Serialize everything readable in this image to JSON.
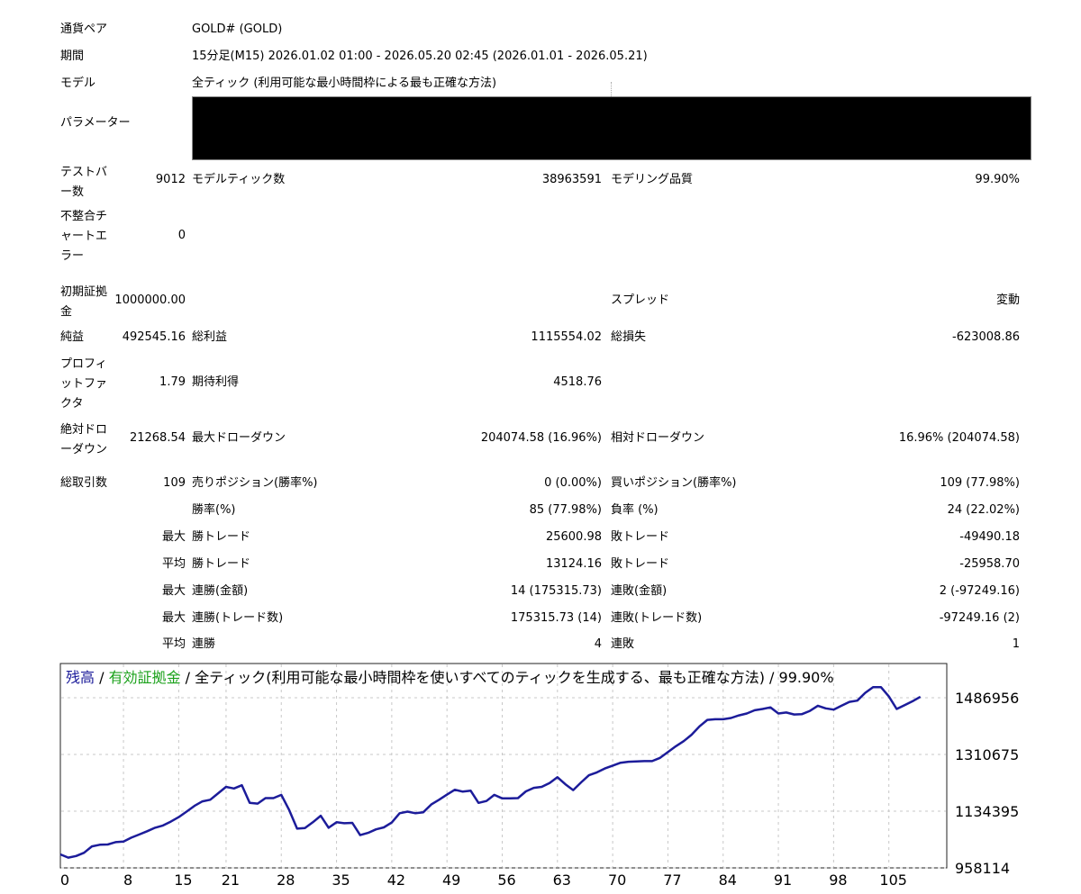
{
  "rows": {
    "pair": {
      "label": "通貨ペア",
      "value": "GOLD# (GOLD)"
    },
    "period": {
      "label": "期間",
      "value": "15分足(M15) 2026.01.02 01:00 - 2026.05.20 02:45 (2026.01.01 - 2026.05.21)"
    },
    "model": {
      "label": "モデル",
      "value": "全ティック (利用可能な最小時間枠による最も正確な方法)"
    },
    "params": {
      "label": "パラメーター"
    },
    "bars": {
      "label": "テストバー数",
      "value": "9012",
      "label2": "モデルティック数",
      "value2": "38963591",
      "label3": "モデリング品質",
      "value3": "99.90%"
    },
    "mismatch": {
      "label": "不整合チャートエラー",
      "value": "0"
    },
    "deposit": {
      "label": "初期証拠金",
      "value": "1000000.00",
      "label3": "スプレッド",
      "value3": "変動"
    },
    "net": {
      "label": "純益",
      "value": "492545.16",
      "label2": "総利益",
      "value2": "1115554.02",
      "label3": "総損失",
      "value3": "-623008.86"
    },
    "pf": {
      "label": "プロフィットファクタ",
      "value": "1.79",
      "label2": "期待利得",
      "value2": "4518.76"
    },
    "dd": {
      "label": "絶対ドローダウン",
      "value": "21268.54",
      "label2": "最大ドローダウン",
      "value2": "204074.58 (16.96%)",
      "label3": "相対ドローダウン",
      "value3": "16.96% (204074.58)"
    },
    "trades": {
      "label": "総取引数",
      "value": "109",
      "label2": "売りポジション(勝率%)",
      "value2": "0 (0.00%)",
      "label3": "買いポジション(勝率%)",
      "value3": "109 (77.98%)"
    },
    "winrate": {
      "label2": "勝率(%)",
      "value2": "85 (77.98%)",
      "label3": "負率 (%)",
      "value3": "24 (22.02%)"
    },
    "maxtrade": {
      "prefix": "最大",
      "label2": "勝トレード",
      "value2": "25600.98",
      "label3": "敗トレード",
      "value3": "-49490.18"
    },
    "avgtrade": {
      "prefix": "平均",
      "label2": "勝トレード",
      "value2": "13124.16",
      "label3": "敗トレード",
      "value3": "-25958.70"
    },
    "maxconsec": {
      "prefix": "最大",
      "label2": "連勝(金額)",
      "value2": "14 (175315.73)",
      "label3": "連敗(金額)",
      "value3": "2 (-97249.16)"
    },
    "maxconsecn": {
      "prefix": "最大",
      "label2": "連勝(トレード数)",
      "value2": "175315.73 (14)",
      "label3": "連敗(トレード数)",
      "value3": "-97249.16 (2)"
    },
    "avgconsec": {
      "prefix": "平均",
      "label2": "連勝",
      "value2": "4",
      "label3": "連敗",
      "value3": "1"
    }
  },
  "chart_data": {
    "type": "line",
    "legend": {
      "balance": "残高",
      "sep1": " / ",
      "equity": "有効証拠金",
      "rest": " / 全ティック(利用可能な最小時間枠を使いすべてのティックを生成する、最も正確な方法) / 99.90%"
    },
    "colors": {
      "balance": "#1c1c9a",
      "equity": "#1aa11a"
    },
    "x_ticks": [
      0,
      8,
      15,
      21,
      28,
      35,
      42,
      49,
      56,
      63,
      70,
      77,
      84,
      91,
      98,
      105
    ],
    "y_ticks": [
      "958114",
      "1134395",
      "1310675",
      "1486956"
    ],
    "ylim": [
      958114,
      1486956
    ],
    "xlim": [
      0,
      112
    ],
    "grid": true,
    "series": [
      {
        "x": [
          0,
          1,
          2,
          3,
          4,
          5,
          6,
          7,
          8,
          9,
          10,
          11,
          12,
          13,
          14,
          15,
          16,
          17,
          18,
          19,
          20,
          21,
          22,
          23,
          24,
          25,
          26,
          27,
          28,
          29,
          30,
          31,
          32,
          33,
          34,
          35,
          36,
          37,
          38,
          39,
          40,
          41,
          42,
          43,
          44,
          45,
          46,
          47,
          48,
          49,
          50,
          51,
          52,
          53,
          54,
          55,
          56,
          57,
          58,
          59,
          60,
          61,
          62,
          63,
          64,
          65,
          66,
          67,
          68,
          69,
          70,
          71,
          72,
          73,
          74,
          75,
          76,
          77,
          78,
          79,
          80,
          81,
          82,
          83,
          84,
          85,
          86,
          87,
          88,
          89,
          90,
          91,
          92,
          93,
          94,
          95,
          96,
          97,
          98,
          99,
          100,
          101,
          102,
          103,
          104,
          105,
          106,
          107,
          108,
          109
        ],
        "values": [
          1000000,
          990000,
          995000,
          1005000,
          1025000,
          1030000,
          1031000,
          1038000,
          1040000,
          1052000,
          1062000,
          1072000,
          1083000,
          1090000,
          1102000,
          1116000,
          1133000,
          1151000,
          1165000,
          1170000,
          1190000,
          1210000,
          1205000,
          1215000,
          1160000,
          1158000,
          1175000,
          1175000,
          1185000,
          1138000,
          1080000,
          1082000,
          1100000,
          1120000,
          1083000,
          1100000,
          1097000,
          1098000,
          1060000,
          1067000,
          1078000,
          1084000,
          1099000,
          1128000,
          1133000,
          1128000,
          1131000,
          1155000,
          1170000,
          1186000,
          1201000,
          1195000,
          1198000,
          1160000,
          1166000,
          1185000,
          1174000,
          1174000,
          1175000,
          1196000,
          1207000,
          1210000,
          1222000,
          1240000,
          1218000,
          1200000,
          1224000,
          1246000,
          1255000,
          1267000,
          1276000,
          1285000,
          1288000,
          1289000,
          1290000,
          1290000,
          1300000,
          1318000,
          1336000,
          1352000,
          1372000,
          1398000,
          1418000,
          1420000,
          1420000,
          1424000,
          1432000,
          1438000,
          1448000,
          1452000,
          1457000,
          1438000,
          1441000,
          1435000,
          1436000,
          1446000,
          1462000,
          1454000,
          1450000,
          1462000,
          1474000,
          1478000,
          1502000,
          1520000,
          1520000,
          1491000,
          1452000,
          1464000,
          1476000,
          1490000
        ]
      }
    ]
  }
}
